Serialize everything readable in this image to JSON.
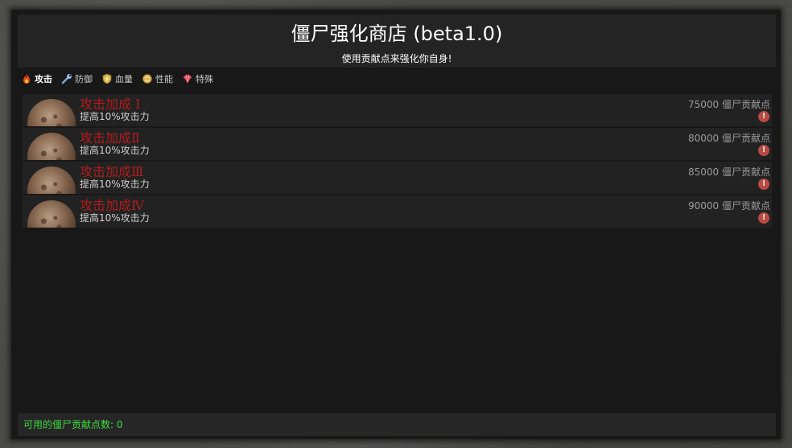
{
  "header": {
    "title": "僵尸强化商店 (beta1.0)",
    "subtitle": "使用贡献点来强化你自身!"
  },
  "tabs": [
    {
      "label": "攻击",
      "icon": "flame-icon",
      "active": true
    },
    {
      "label": "防御",
      "icon": "wrench-icon",
      "active": false
    },
    {
      "label": "血量",
      "icon": "shield-icon",
      "active": false
    },
    {
      "label": "性能",
      "icon": "coin-icon",
      "active": false
    },
    {
      "label": "特殊",
      "icon": "gem-icon",
      "active": false
    }
  ],
  "items": [
    {
      "name": "攻击加成 Ⅰ",
      "desc": "提高10%攻击力",
      "price": "75000 僵尸贡献点",
      "alert": "!"
    },
    {
      "name": "攻击加成Ⅱ",
      "desc": "提高10%攻击力",
      "price": "80000 僵尸贡献点",
      "alert": "!"
    },
    {
      "name": "攻击加成Ⅲ",
      "desc": "提高10%攻击力",
      "price": "85000 僵尸贡献点",
      "alert": "!"
    },
    {
      "name": "攻击加成Ⅳ",
      "desc": "提高10%攻击力",
      "price": "90000 僵尸贡献点",
      "alert": "!"
    }
  ],
  "footer": {
    "points_text": "可用的僵尸贡献点数: 0"
  },
  "colors": {
    "item_name": "#b01c1c",
    "footer_text": "#3fdc3f",
    "alert": "#b74a43"
  }
}
